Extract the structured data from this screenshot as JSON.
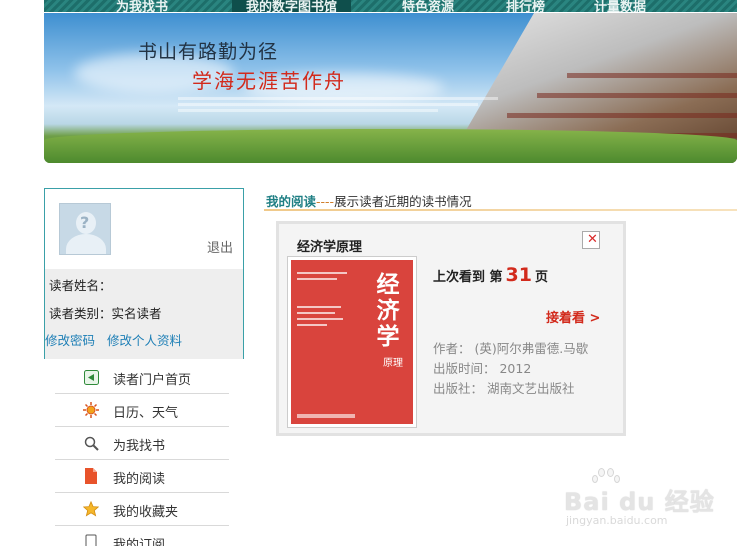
{
  "nav": {
    "items": [
      "为我找书",
      "我的数字图书馆",
      "特色资源",
      "排行榜",
      "计量数据"
    ]
  },
  "banner": {
    "line1": "书山有路勤为径",
    "line2": "学海无涯苦作舟"
  },
  "user": {
    "logout": "退出",
    "name_label": "读者姓名：",
    "type_label": "读者类别：",
    "type_value": "实名读者",
    "change_password": "修改密码",
    "edit_profile": "修改个人资料"
  },
  "menu": [
    {
      "label": "读者门户首页",
      "icon": "portal-home-icon"
    },
    {
      "label": "日历、天气",
      "icon": "weather-sun-icon"
    },
    {
      "label": "为我找书",
      "icon": "search-icon"
    },
    {
      "label": "我的阅读",
      "icon": "book-icon"
    },
    {
      "label": "我的收藏夹",
      "icon": "star-icon"
    },
    {
      "label": "我的订阅",
      "icon": "subscribe-icon"
    }
  ],
  "section": {
    "title": "我的阅读",
    "separator": "----",
    "description": "展示读者近期的读书情况"
  },
  "book": {
    "title": "经济学原理",
    "progress_prefix": "上次看到 第",
    "page": "31",
    "progress_suffix": "页",
    "continue_label": "接着看 >",
    "author": "作者： (英)阿尔弗雷德.马歇",
    "published": "出版时间： 2012",
    "publisher": "出版社： 湖南文艺出版社",
    "cover_title": "经济学",
    "cover_sub": "原理"
  },
  "watermark": {
    "brand": "Bai du 经验",
    "url": "jingyan.baidu.com"
  }
}
